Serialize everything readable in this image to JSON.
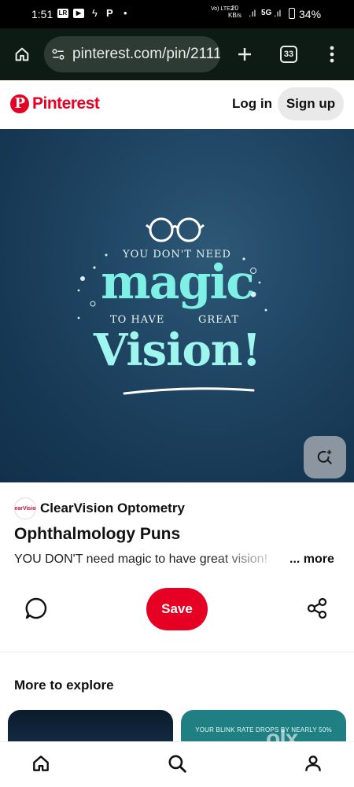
{
  "status_bar": {
    "time": "1:51",
    "icons": [
      "lr-icon",
      "youtube-icon",
      "flash-icon",
      "p-icon",
      "dot"
    ],
    "network_text": "Vo) LTE2",
    "speed_value": "20",
    "speed_unit": "KB/s",
    "signal": "5G",
    "battery": "34%"
  },
  "browser": {
    "url": "pinterest.com/pin/2111",
    "tab_count": "33"
  },
  "header": {
    "brand": "Pinterest",
    "login_label": "Log in",
    "signup_label": "Sign up"
  },
  "pin_image": {
    "line1": "YOU DON'T NEED",
    "big1": "magic",
    "line2_left": "TO HAVE",
    "line2_right": "GREAT",
    "big2": "Vision!"
  },
  "pin": {
    "creator_avatar_text": "earVisio",
    "creator": "ClearVision Optometry",
    "title": "Ophthalmology Puns",
    "description": "YOU DON'T need magic to have great vision!",
    "more_label": "... more",
    "save_label": "Save"
  },
  "explore": {
    "heading": "More to explore",
    "card2_text": "YOUR BLINK RATE DROPS BY NEARLY 50%"
  },
  "watermark": "olx",
  "colors": {
    "brand": "#e60023",
    "chrome_bg": "#0e1b14",
    "pin_bg": "#1f4563",
    "accent_text": "#7ff0e6"
  }
}
